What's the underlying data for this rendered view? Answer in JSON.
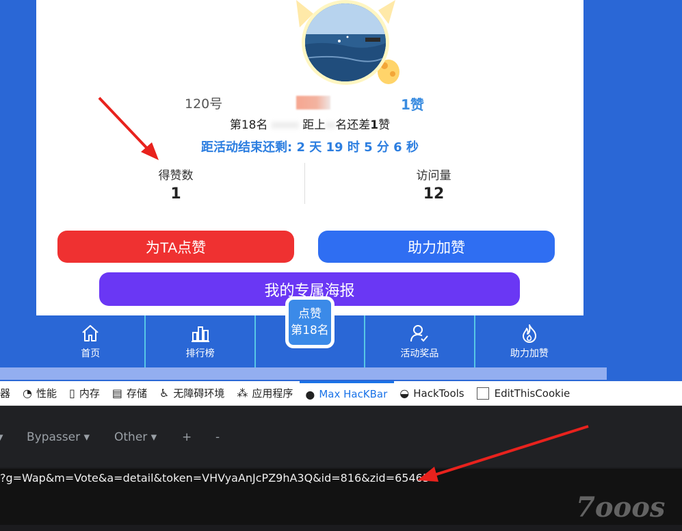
{
  "profile": {
    "number": "120号",
    "likes": "1赞",
    "rank_prefix": "第18名",
    "rank_middle": "距上",
    "rank_suffix": "名还差",
    "rank_gap": "1",
    "rank_unit": "赞",
    "countdown": "距活动结束还剩: 2 天 19 时 5 分 6 秒"
  },
  "stats": {
    "likes_label": "得赞数",
    "likes_value": "1",
    "visits_label": "访问量",
    "visits_value": "12"
  },
  "buttons": {
    "vote": "为TA点赞",
    "boost": "助力加赞",
    "poster": "我的专属海报"
  },
  "nav": {
    "home": "首页",
    "ranking": "排行榜",
    "center_line1": "点赞",
    "center_line2": "第18名",
    "prizes": "活动奖品",
    "boost": "助力加赞"
  },
  "devtools": {
    "tabs": [
      "器",
      "性能",
      "内存",
      "存储",
      "无障碍环境",
      "应用程序",
      "Max HacKBar",
      "HackTools",
      "EditThisCookie"
    ],
    "active_tab": "Max HacKBar"
  },
  "hackbar": {
    "menu_bypasser": "Bypasser ▾",
    "menu_other": "Other ▾",
    "menu_plus": "+",
    "menu_minus": "-",
    "url": "?g=Wap&m=Vote&a=detail&token=VHVyaAnJcPZ9hA3Q&id=816&zid=65465"
  },
  "watermark": "7ooos",
  "colors": {
    "page_bg": "#2a67d6",
    "vote_button": "#ef3131",
    "boost_button": "#2f6ef2",
    "poster_button": "#6a37f4",
    "countdown_text": "#2c7ee0",
    "active_tab": "#1a73e8",
    "arrow": "#e8221d"
  }
}
